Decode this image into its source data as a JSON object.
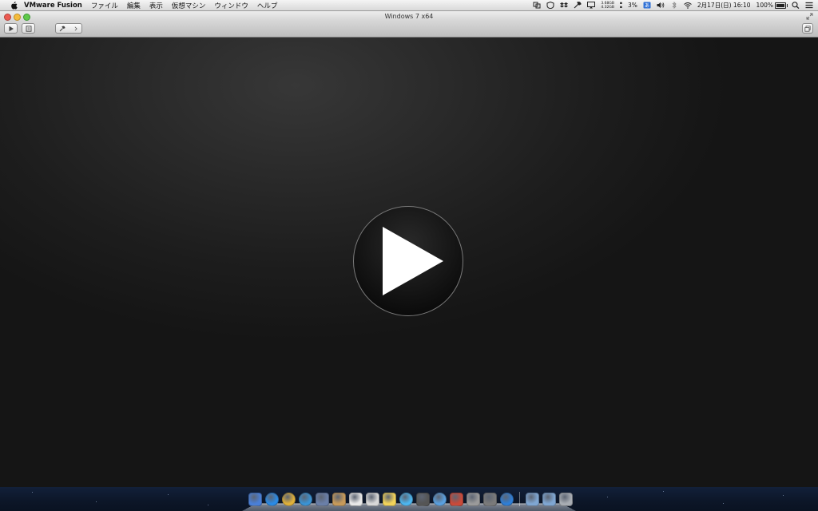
{
  "menubar": {
    "app_name": "VMware Fusion",
    "items": [
      "ファイル",
      "編集",
      "表示",
      "仮想マシン",
      "ウィンドウ",
      "ヘルプ"
    ],
    "memory": {
      "top": "3.68GB",
      "bottom": "4.32GB"
    },
    "cpu": "3%",
    "datetime": "2月17日(日) 16:10",
    "battery": "100%",
    "battery_level": 1.0
  },
  "window": {
    "title": "Windows 7 x64"
  },
  "toolbar": {
    "buttons": [
      "play-icon",
      "snapshot-icon",
      "settings-icon"
    ]
  },
  "vm": {
    "play_button_icon": "play-icon"
  },
  "dock": {
    "apps": [
      {
        "name": "finder",
        "color": "#4a7fd6"
      },
      {
        "name": "app-store",
        "color": "#2b8be6"
      },
      {
        "name": "chrome",
        "color": "#e0b13a"
      },
      {
        "name": "safari",
        "color": "#3a93d4"
      },
      {
        "name": "preview",
        "color": "#6a7fa8"
      },
      {
        "name": "notebook",
        "color": "#c69a5a"
      },
      {
        "name": "calendar",
        "color": "#e8e8e8"
      },
      {
        "name": "text-edit",
        "color": "#d8d8d8"
      },
      {
        "name": "stickies",
        "color": "#f2d35a"
      },
      {
        "name": "messages",
        "color": "#4db6ef"
      },
      {
        "name": "facetime",
        "color": "#555555"
      },
      {
        "name": "itunes",
        "color": "#5aa0e0"
      },
      {
        "name": "vmware-fusion",
        "color": "#c94a3a"
      },
      {
        "name": "disk-utility",
        "color": "#9a9a9a"
      },
      {
        "name": "terminal",
        "color": "#7a7a7a"
      },
      {
        "name": "search",
        "color": "#2f7ed6"
      }
    ],
    "right_items": [
      {
        "name": "folder-documents",
        "color": "#7fa6d2"
      },
      {
        "name": "folder-downloads",
        "color": "#7fa6d2"
      },
      {
        "name": "trash",
        "color": "#a9adb3"
      }
    ]
  }
}
